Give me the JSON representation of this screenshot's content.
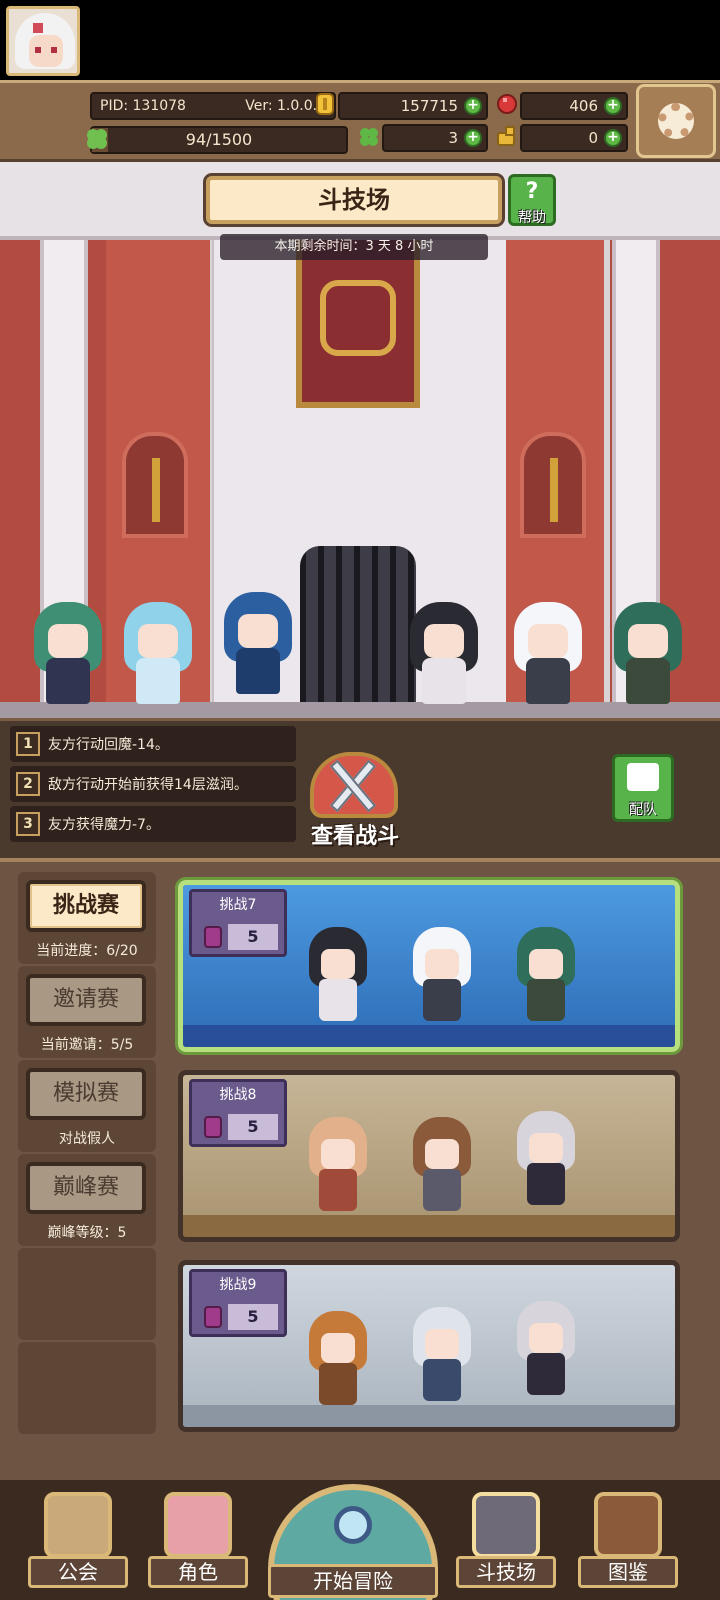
{
  "header": {
    "pid": "PID: 131078",
    "version": "Ver: 1.0.0.7",
    "exp": "94/1500",
    "exp_fill": 0.063,
    "gold": "157715",
    "ruby": "406",
    "clover": "3",
    "item": "0"
  },
  "arena": {
    "title": "斗技场",
    "help_label": "帮助",
    "help_icon": "?",
    "remaining": "本期剩余时间：3 天 8 小时"
  },
  "battle": {
    "logs": [
      {
        "num": "1",
        "text": "友方行动回魔-14。"
      },
      {
        "num": "2",
        "text": "敌方行动开始前获得14层滋润。"
      },
      {
        "num": "3",
        "text": "友方获得魔力-7。"
      }
    ],
    "view_label": "查看战斗",
    "team_label": "配队"
  },
  "modes": [
    {
      "label": "挑战赛",
      "sub": "当前进度：6/20",
      "active": true
    },
    {
      "label": "邀请赛",
      "sub": "当前邀请：5/5",
      "active": false
    },
    {
      "label": "模拟赛",
      "sub": "对战假人",
      "active": false
    },
    {
      "label": "巅峰赛",
      "sub": "巅峰等级：5",
      "active": false
    }
  ],
  "challenges": [
    {
      "title": "挑战7",
      "cost": "5",
      "active": true
    },
    {
      "title": "挑战8",
      "cost": "5",
      "active": false
    },
    {
      "title": "挑战9",
      "cost": "5",
      "active": false
    }
  ],
  "nav": {
    "guild": "公会",
    "character": "角色",
    "adventure": "开始冒险",
    "arena": "斗技场",
    "codex": "图鉴"
  },
  "colors": {
    "accent_green": "#57b34a",
    "panel_brown": "#6d5443",
    "active_card_border": "#b6e07e"
  }
}
